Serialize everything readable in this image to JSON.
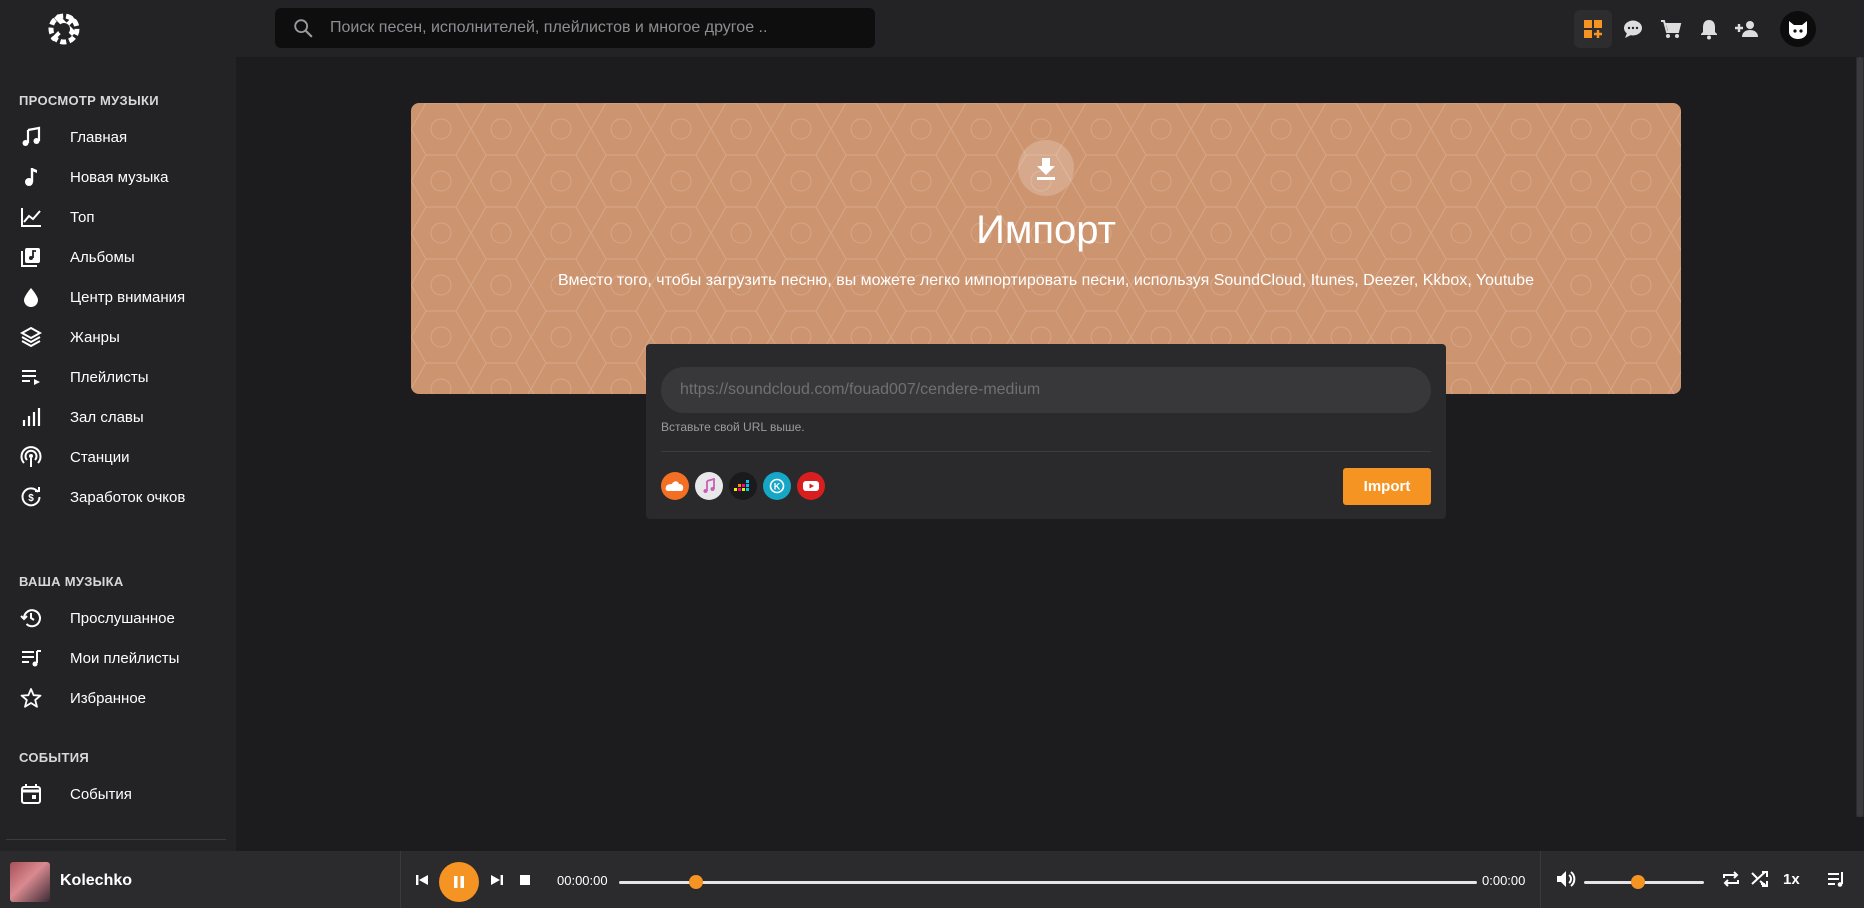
{
  "header": {
    "search_placeholder": "Поиск песен, исполнителей, плейлистов и многое другое ..",
    "accent_color": "#f59422",
    "icons": [
      "grid-add-icon",
      "chat-icon",
      "cart-icon",
      "bell-icon",
      "add-user-icon",
      "avatar-cat-icon"
    ]
  },
  "sidebar": {
    "browse_title": "ПРОСМОТР МУЗЫКИ",
    "browse_items": [
      {
        "label": "Главная",
        "icon": "music-note-icon"
      },
      {
        "label": "Новая музыка",
        "icon": "single-note-icon"
      },
      {
        "label": "Топ",
        "icon": "chart-line-icon"
      },
      {
        "label": "Альбомы",
        "icon": "album-icon"
      },
      {
        "label": "Центр внимания",
        "icon": "drop-icon"
      },
      {
        "label": "Жанры",
        "icon": "layers-icon"
      },
      {
        "label": "Плейлисты",
        "icon": "playlist-icon"
      },
      {
        "label": "Зал славы",
        "icon": "bar-chart-icon"
      },
      {
        "label": "Станции",
        "icon": "radio-icon"
      },
      {
        "label": "Заработок очков",
        "icon": "dollar-cycle-icon"
      }
    ],
    "your_title": "ВАША МУЗЫКА",
    "your_items": [
      {
        "label": "Прослушанное",
        "icon": "history-icon"
      },
      {
        "label": "Мои плейлисты",
        "icon": "my-playlist-icon"
      },
      {
        "label": "Избранное",
        "icon": "star-icon"
      }
    ],
    "events_title": "СОБЫТИЯ",
    "events_items": [
      {
        "label": "События",
        "icon": "calendar-icon"
      }
    ]
  },
  "banner": {
    "title": "Импорт",
    "description": "Вместо того, чтобы загрузить песню, вы можете легко импортировать песни, используя SoundCloud, Itunes, Deezer, Kkbox, Youtube",
    "bg_color": "#cd9470"
  },
  "import_card": {
    "url_placeholder": "https://soundcloud.com/fouad007/cendere-medium",
    "hint": "Вставьте свой URL выше.",
    "button_label": "Import",
    "services": [
      "soundcloud-icon",
      "itunes-icon",
      "deezer-icon",
      "kkbox-icon",
      "youtube-icon"
    ]
  },
  "player": {
    "track_name": "Kolechko",
    "current_time": "00:00:00",
    "duration": "0:00:00",
    "progress_fraction": 0.09,
    "volume_fraction": 0.45,
    "speed": "1x"
  }
}
